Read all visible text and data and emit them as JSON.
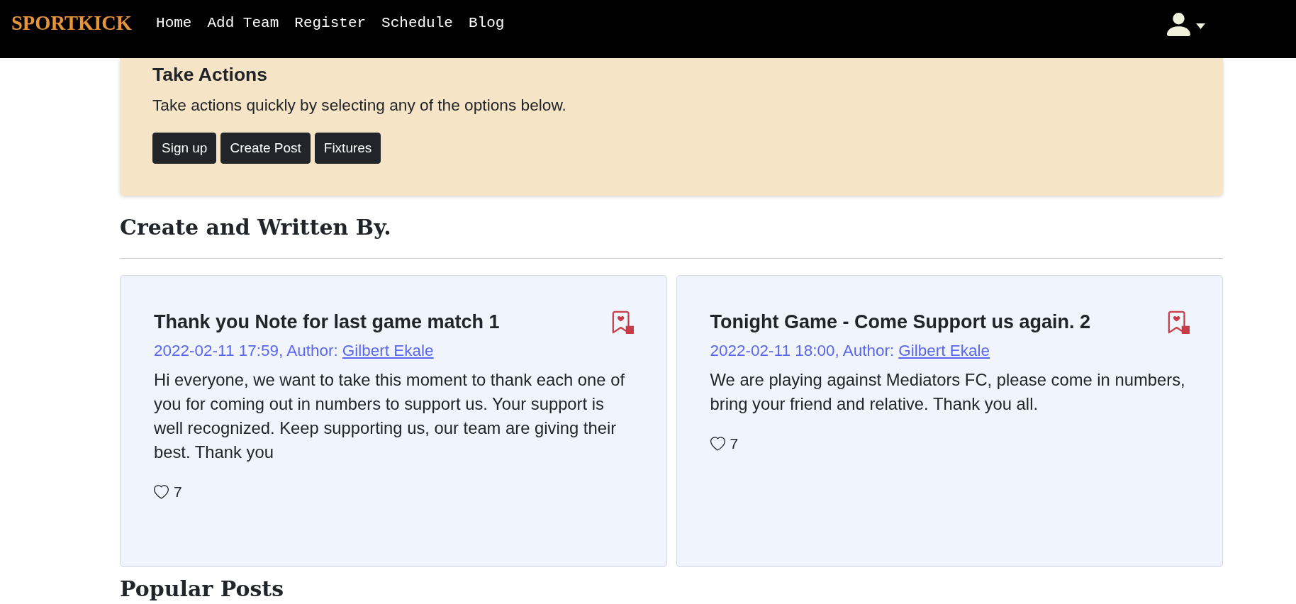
{
  "navbar": {
    "brand": "SPORTKICK",
    "links": [
      "Home",
      "Add Team",
      "Register",
      "Schedule",
      "Blog"
    ]
  },
  "actions_panel": {
    "title": "Take Actions",
    "description": "Take actions quickly by selecting any of the options below.",
    "buttons": [
      "Sign up",
      "Create Post",
      "Fixtures"
    ]
  },
  "section_title": "Create and Written By.",
  "posts": [
    {
      "title": "Thank you Note for last game match 1",
      "meta": "2022-02-11 17:59, Author:",
      "author": "Gilbert Ekale",
      "body": "Hi everyone, we want to take this moment to thank each one of you for coming out in numbers to support us. Your support is well recognized. Keep supporting us, our team are giving their best. Thank you",
      "likes": "7"
    },
    {
      "title": "Tonight Game - Come Support us again. 2",
      "meta": "2022-02-11 18:00, Author:",
      "author": "Gilbert Ekale",
      "body": "We are playing against Mediators FC, please come in numbers, bring your friend and relative. Thank you all.",
      "likes": "7"
    }
  ],
  "next_section_title": "Popular Posts"
}
